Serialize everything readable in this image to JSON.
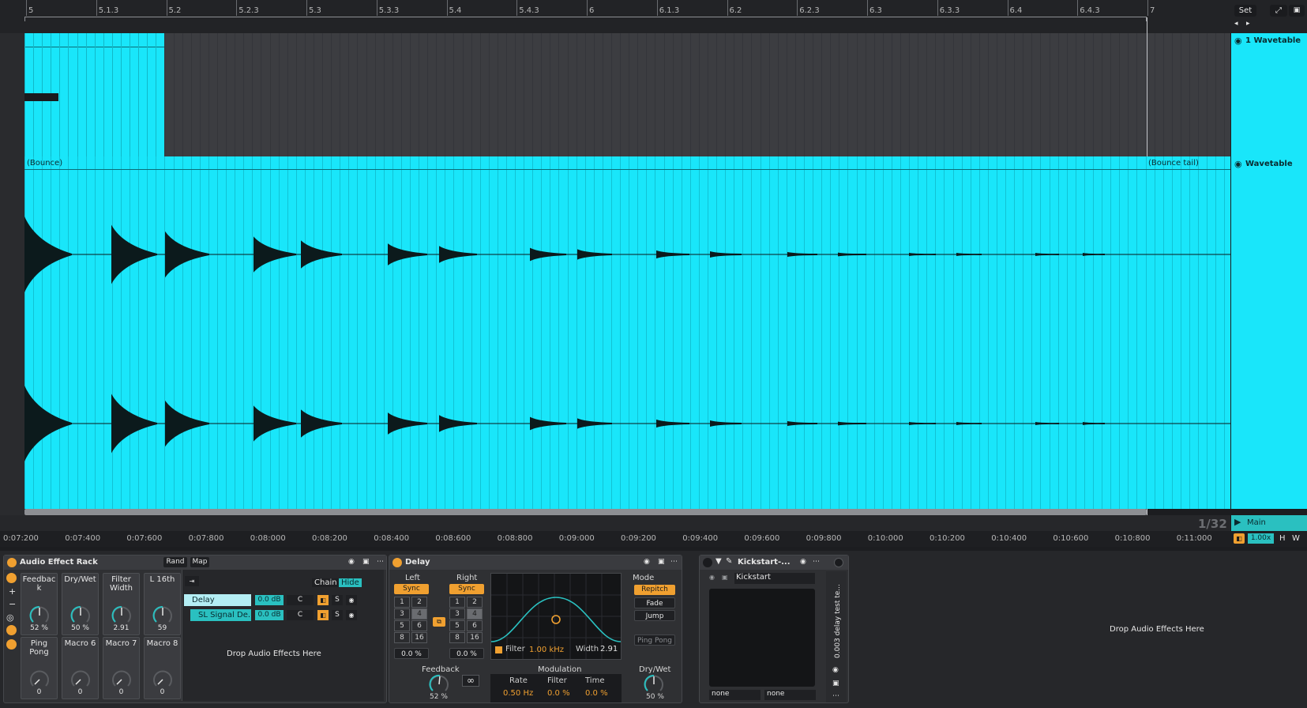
{
  "ruler": {
    "bars": [
      "5",
      "5.1.3",
      "5.2",
      "5.2.3",
      "5.3",
      "5.3.3",
      "5.4",
      "5.4.3",
      "6",
      "6.1.3",
      "6.2",
      "6.2.3",
      "6.3",
      "6.3.3",
      "6.4",
      "6.4.3",
      "7"
    ]
  },
  "top_right": {
    "set_label": "Set"
  },
  "tracks": {
    "track1_name": "1 Wavetable",
    "track2_name": "Wavetable",
    "clip_bounce": "(Bounce)",
    "clip_bounce_tail": "(Bounce tail)",
    "main_label": "Main"
  },
  "timeline": {
    "times": [
      "0:07:200",
      "0:07:400",
      "0:07:600",
      "0:07:800",
      "0:08:000",
      "0:08:200",
      "0:08:400",
      "0:08:600",
      "0:08:800",
      "0:09:000",
      "0:09:200",
      "0:09:400",
      "0:09:600",
      "0:09:800",
      "0:10:000",
      "0:10:200",
      "0:10:400",
      "0:10:600",
      "0:10:800",
      "0:11:000"
    ],
    "grid": "1/32",
    "zoom": "1.00x",
    "h_label": "H",
    "w_label": "W"
  },
  "rack": {
    "title": "Audio Effect Rack",
    "rand": "Rand",
    "map": "Map",
    "chain": "Chain",
    "hide": "Hide",
    "macros": [
      {
        "name": "Feedbac k",
        "value": "52 %"
      },
      {
        "name": "Dry/Wet",
        "value": "50 %"
      },
      {
        "name": "Filter Width",
        "value": "2.91"
      },
      {
        "name": "L 16th",
        "value": "59"
      },
      {
        "name": "Ping Pong",
        "value": "0"
      },
      {
        "name": "Macro 6",
        "value": "0"
      },
      {
        "name": "Macro 7",
        "value": "0"
      },
      {
        "name": "Macro 8",
        "value": "0"
      }
    ],
    "chains": [
      {
        "name": "Delay",
        "vol": "0.0 dB",
        "pan": "C",
        "solo": "S"
      },
      {
        "name": "SL Signal De...",
        "vol": "0.0 dB",
        "pan": "C",
        "solo": "S"
      }
    ],
    "drop_text": "Drop Audio Effects Here"
  },
  "delay": {
    "title": "Delay",
    "left_label": "Left",
    "right_label": "Right",
    "sync": "Sync",
    "grid_values": [
      "1",
      "2",
      "3",
      "4",
      "5",
      "6",
      "8",
      "16"
    ],
    "left_offset": "0.0 %",
    "right_offset": "0.0 %",
    "mode_label": "Mode",
    "modes": [
      "Repitch",
      "Fade",
      "Jump"
    ],
    "ping_pong": "Ping Pong",
    "filter_label": "Filter",
    "filter_freq": "1.00 kHz",
    "width_label": "Width",
    "width_value": "2.91",
    "feedback_label": "Feedback",
    "feedback_value": "52 %",
    "modulation_label": "Modulation",
    "rate_label": "Rate",
    "rate_value": "0.50 Hz",
    "mod_filter_label": "Filter",
    "mod_filter_value": "0.0 %",
    "time_label": "Time",
    "time_value": "0.0 %",
    "drywet_label": "Dry/Wet",
    "drywet_value": "50 %"
  },
  "kickstart": {
    "title": "Kickstart-...",
    "preset": "Kickstart",
    "in1": "none",
    "in2": "none",
    "side_label": "0.003 delay test te..."
  },
  "right_drop": "Drop Audio Effects Here",
  "colors": {
    "clip": "#19e6fa",
    "accent": "#f0a030"
  }
}
